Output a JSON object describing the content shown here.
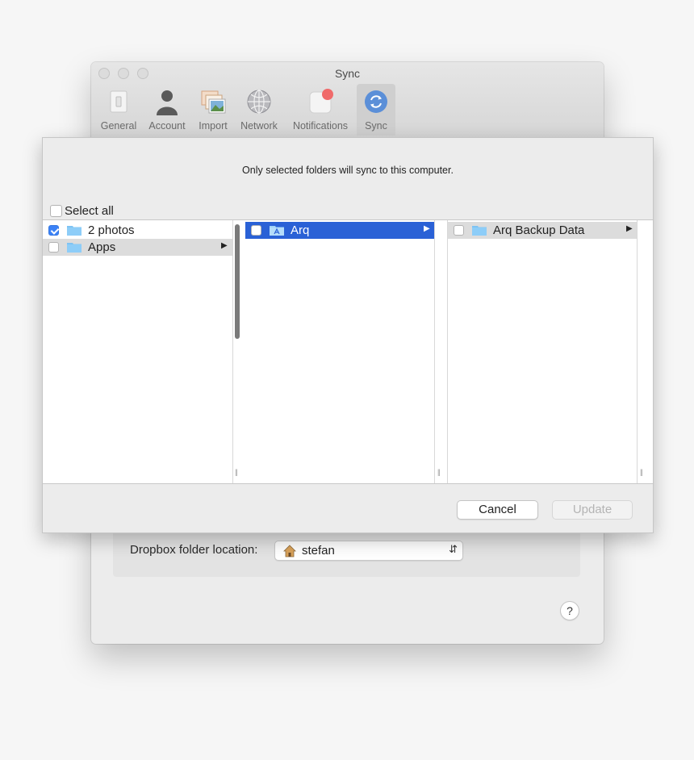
{
  "window": {
    "title": "Sync"
  },
  "toolbar": {
    "items": [
      {
        "label": "General",
        "icon": "switch-icon"
      },
      {
        "label": "Account",
        "icon": "person-icon"
      },
      {
        "label": "Import",
        "icon": "photos-icon"
      },
      {
        "label": "Network",
        "icon": "globe-icon"
      },
      {
        "label": "Notifications",
        "icon": "notification-icon"
      },
      {
        "label": "Sync",
        "icon": "sync-icon",
        "selected": true
      }
    ]
  },
  "sheet": {
    "message": "Only selected folders will sync to this computer.",
    "select_all_label": "Select all",
    "columns": [
      {
        "rows": [
          {
            "label": "2 photos",
            "checked": true,
            "has_children": false
          },
          {
            "label": "Apps",
            "checked": false,
            "has_children": true,
            "highlighted": true
          }
        ]
      },
      {
        "rows": [
          {
            "label": "Arq",
            "checked": false,
            "has_children": true,
            "selected": true
          }
        ]
      },
      {
        "rows": [
          {
            "label": "Arq Backup Data",
            "checked": false,
            "has_children": true,
            "highlighted": true
          }
        ]
      }
    ],
    "cancel_label": "Cancel",
    "update_label": "Update"
  },
  "prefs": {
    "folder_location_label": "Dropbox folder location:",
    "folder_location_value": "stefan",
    "help_label": "?"
  },
  "colors": {
    "selection": "#2a61d6",
    "checkbox_checked": "#3b82f7",
    "folder": "#7ec3f3",
    "notification_badge": "#f06a6a"
  }
}
